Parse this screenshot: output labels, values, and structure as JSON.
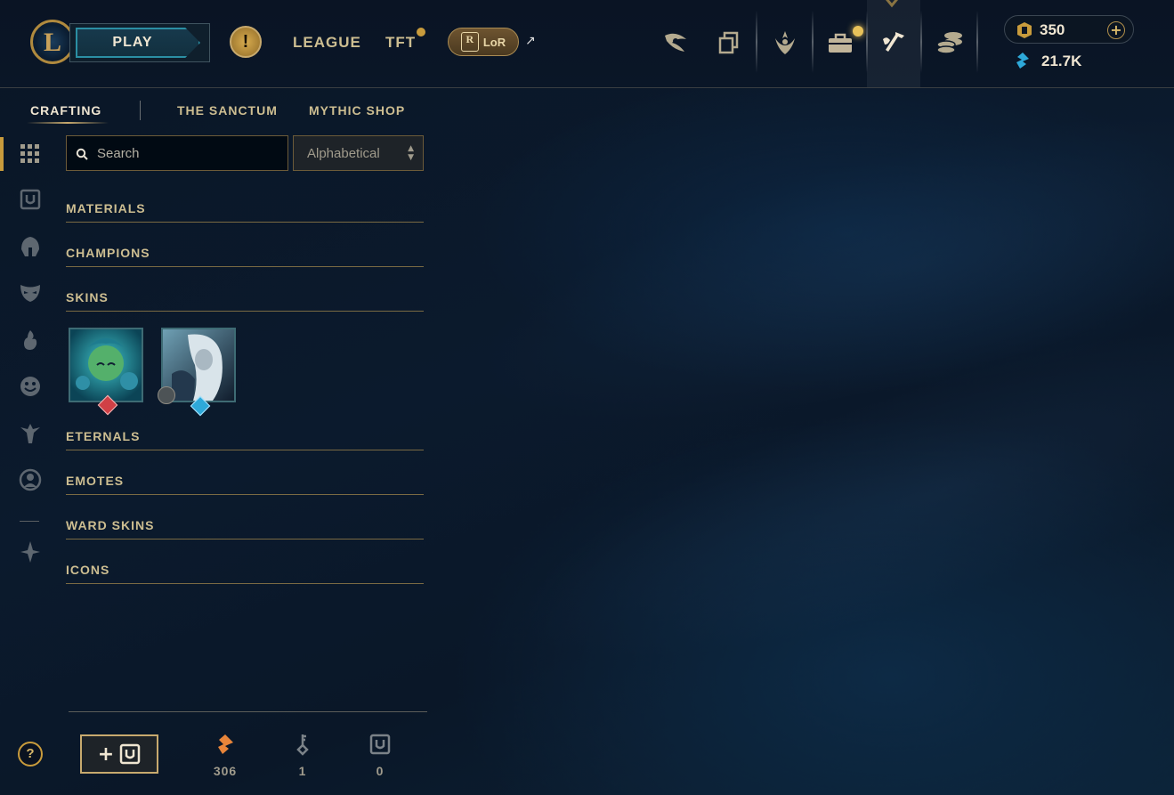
{
  "header": {
    "logo_letter": "L",
    "play_label": "PLAY",
    "alert_symbol": "!",
    "nav": {
      "league": "LEAGUE",
      "tft": "TFT",
      "lor_badge": "R",
      "lor": "LoR",
      "external_symbol": "↗"
    },
    "icons": [
      "clash-icon",
      "collection-icon",
      "ranked-emblem-icon",
      "loot-chest-icon",
      "crafting-hammer-icon",
      "store-coins-icon"
    ],
    "currency": {
      "rp": "350",
      "be": "21.7K",
      "add_symbol": "+"
    }
  },
  "subnav": {
    "tabs": [
      "CRAFTING",
      "THE SANCTUM",
      "MYTHIC SHOP"
    ],
    "active": "CRAFTING"
  },
  "rail": {
    "icons": [
      "grid-icon",
      "chest-icon",
      "champion-helmet-icon",
      "skin-mask-icon",
      "summoner-flame-icon",
      "emote-face-icon",
      "ward-icon",
      "profile-icon",
      "mythic-icon"
    ]
  },
  "toolbar": {
    "search_placeholder": "Search",
    "sort_value": "Alphabetical",
    "sort_up": "▲",
    "sort_down": "▼"
  },
  "categories": [
    "MATERIALS",
    "CHAMPIONS",
    "SKINS",
    "ETERNALS",
    "EMOTES",
    "WARD SKINS",
    "ICONS"
  ],
  "skins": [
    {
      "gem": "red-gem-icon",
      "colors": [
        "#1a8ea0",
        "#0c4a5e"
      ]
    },
    {
      "gem": "blue-gem-icon",
      "colors": [
        "#4d7890",
        "#12253a"
      ]
    }
  ],
  "footer": {
    "help_symbol": "?",
    "add_symbol": "+",
    "resources": [
      {
        "icon": "orange-essence-icon",
        "count": "306"
      },
      {
        "icon": "key-icon",
        "count": "1"
      },
      {
        "icon": "chest-icon",
        "count": "0"
      }
    ]
  },
  "colors": {
    "gold": "#c8aa6e",
    "accent_gold": "#c89b3c",
    "teal": "#2b8fa4",
    "text": "#cdbe91"
  }
}
